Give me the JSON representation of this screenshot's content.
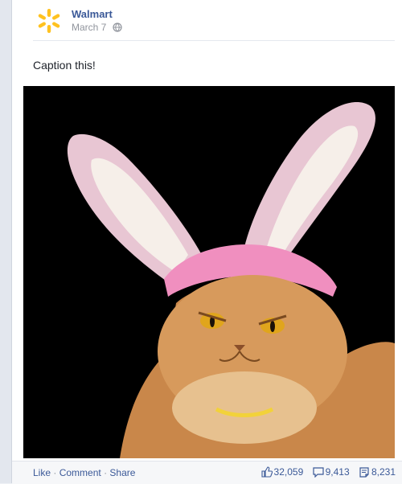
{
  "post": {
    "page_name": "Walmart",
    "date": "March 7",
    "caption": "Caption this!",
    "photo_subject": "",
    "icons": {
      "logo": "walmart-spark-logo",
      "audience": "globe-icon",
      "like": "thumbs-up-icon",
      "comment": "comment-icon",
      "share": "share-icon"
    },
    "colors": {
      "link": "#3b5998",
      "logo_yellow": "#ffc220",
      "photo_bg": "#000000"
    }
  },
  "footer": {
    "like_label": "Like",
    "comment_label": "Comment",
    "share_label": "Share",
    "separator": "·",
    "like_count": "32,059",
    "comment_count": "9,413",
    "share_count": "8,231"
  }
}
